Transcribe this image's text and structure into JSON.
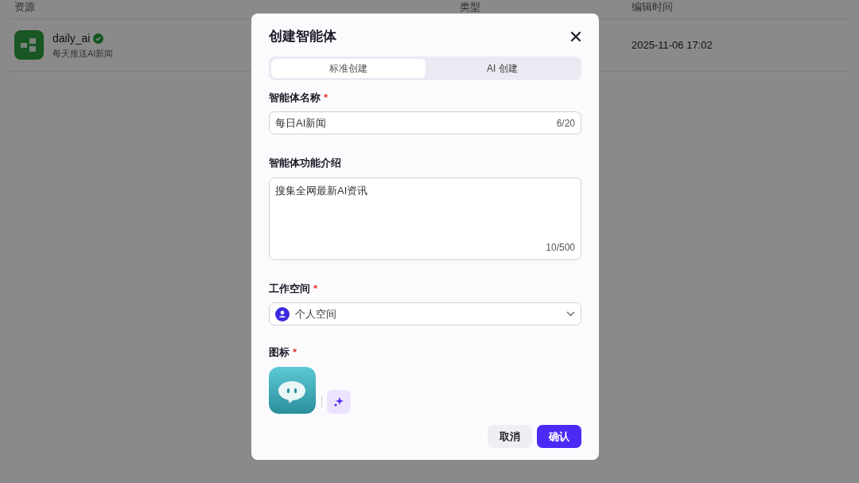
{
  "table": {
    "columns": [
      "资源",
      "类型",
      "编辑时间"
    ],
    "rows": [
      {
        "name": "daily_ai",
        "verified": true,
        "description": "每天推送AI新闻",
        "edited": "2025-11-06 17:02"
      }
    ]
  },
  "dialog": {
    "title": "创建智能体",
    "tabs": [
      {
        "label": "标准创建",
        "selected": true
      },
      {
        "label": "AI 创建",
        "selected": false
      }
    ],
    "fields": [
      {
        "kind": "text",
        "label": "智能体名称",
        "required_mark": "*",
        "value": "每日AI新闻",
        "counter": "6/20"
      },
      {
        "kind": "textarea",
        "label": "智能体功能介绍",
        "value": "搜集全网最新AI资讯",
        "counter": "10/500"
      },
      {
        "kind": "select",
        "label": "工作空间",
        "required_mark": "*",
        "value": "个人空间"
      },
      {
        "kind": "icon",
        "label": "图标",
        "required_mark": "*"
      }
    ],
    "buttons": [
      {
        "label": "取消",
        "primary": false
      },
      {
        "label": "确认",
        "primary": true
      }
    ]
  }
}
